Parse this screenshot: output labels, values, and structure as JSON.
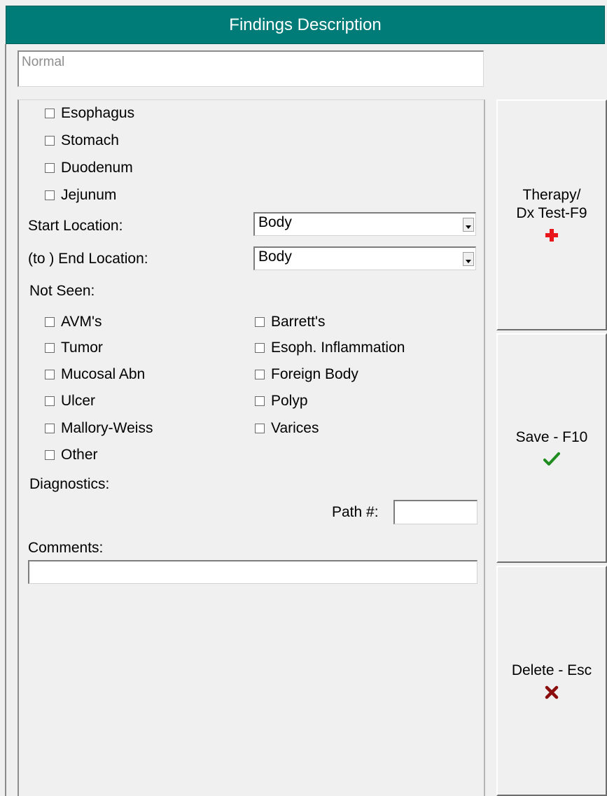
{
  "title": "Findings Description",
  "findings_input": {
    "value": "Normal"
  },
  "organs": [
    {
      "label": "Esophagus",
      "checked": false
    },
    {
      "label": "Stomach",
      "checked": false
    },
    {
      "label": "Duodenum",
      "checked": false
    },
    {
      "label": "Jejunum",
      "checked": false
    }
  ],
  "start_location": {
    "label": "Start Location:",
    "value": "Body"
  },
  "end_location": {
    "label": "(to ) End Location:",
    "value": "Body"
  },
  "not_seen": {
    "label": "Not Seen:",
    "left": [
      {
        "label": "AVM's",
        "checked": false
      },
      {
        "label": "Tumor",
        "checked": false
      },
      {
        "label": "Mucosal Abn",
        "checked": false
      },
      {
        "label": "Ulcer",
        "checked": false
      },
      {
        "label": "Mallory-Weiss",
        "checked": false
      },
      {
        "label": "Other",
        "checked": false
      }
    ],
    "right": [
      {
        "label": "Barrett's",
        "checked": false
      },
      {
        "label": "Esoph. Inflammation",
        "checked": false
      },
      {
        "label": "Foreign Body",
        "checked": false
      },
      {
        "label": "Polyp",
        "checked": false
      },
      {
        "label": "Varices",
        "checked": false
      }
    ]
  },
  "diagnostics": {
    "label": "Diagnostics:"
  },
  "path": {
    "label": "Path #:",
    "value": ""
  },
  "comments": {
    "label": "Comments:",
    "value": ""
  },
  "buttons": {
    "therapy": {
      "label": "Therapy/\nDx Test-F9",
      "icon": "red-cross-icon",
      "color": "#e8151b"
    },
    "save": {
      "label": "Save - F10",
      "icon": "green-check-icon",
      "color": "#1f8c1f"
    },
    "delete": {
      "label": "Delete - Esc",
      "icon": "red-x-icon",
      "color": "#8b0d0d"
    }
  },
  "colors": {
    "title_bg": "#007c78",
    "window_bg": "#f0f0f0"
  }
}
